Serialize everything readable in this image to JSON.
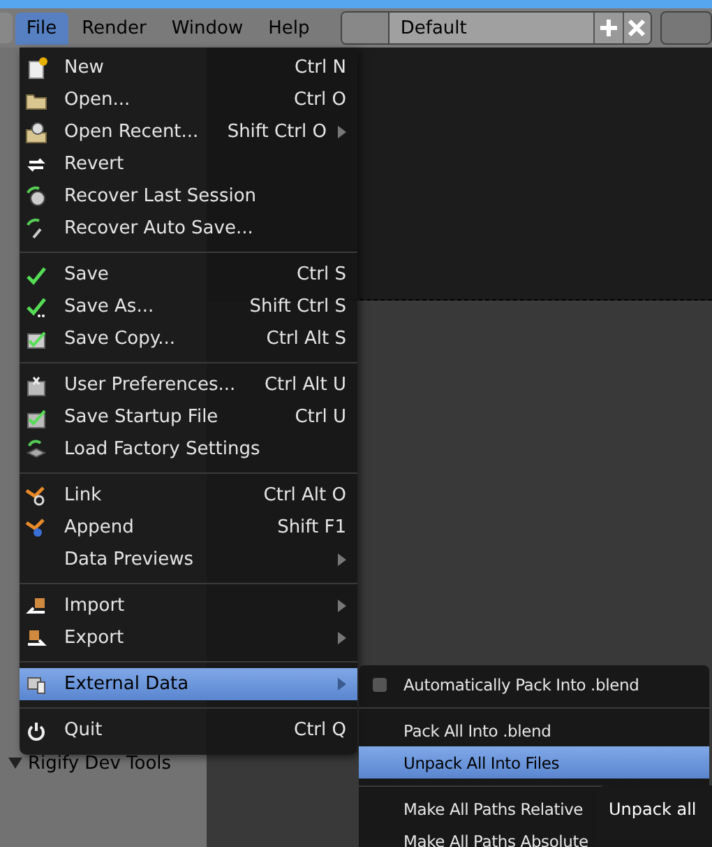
{
  "header": {
    "menus": [
      {
        "label": "File",
        "selected": true
      },
      {
        "label": "Render",
        "selected": false
      },
      {
        "label": "Window",
        "selected": false
      },
      {
        "label": "Help",
        "selected": false
      }
    ],
    "layout": "Default"
  },
  "toolshelf": {
    "panels": [
      {
        "label": "Rigify Dev Tools",
        "expanded": true
      }
    ]
  },
  "file_menu": {
    "sections": [
      [
        {
          "label": "New",
          "shortcut": "Ctrl N",
          "submenu": false,
          "selected": false
        },
        {
          "label": "Open...",
          "shortcut": "Ctrl O",
          "submenu": false,
          "selected": false
        },
        {
          "label": "Open Recent...",
          "shortcut": "Shift Ctrl O",
          "submenu": true,
          "selected": false
        },
        {
          "label": "Revert",
          "submenu": false,
          "selected": false
        },
        {
          "label": "Recover Last Session",
          "submenu": false,
          "selected": false
        },
        {
          "label": "Recover Auto Save...",
          "submenu": false,
          "selected": false
        }
      ],
      [
        {
          "label": "Save",
          "shortcut": "Ctrl S",
          "submenu": false,
          "selected": false
        },
        {
          "label": "Save As...",
          "shortcut": "Shift Ctrl S",
          "submenu": false,
          "selected": false
        },
        {
          "label": "Save Copy...",
          "shortcut": "Ctrl Alt S",
          "submenu": false,
          "selected": false
        }
      ],
      [
        {
          "label": "User Preferences...",
          "shortcut": "Ctrl Alt U",
          "submenu": false,
          "selected": false
        },
        {
          "label": "Save Startup File",
          "shortcut": "Ctrl U",
          "submenu": false,
          "selected": false
        },
        {
          "label": "Load Factory Settings",
          "submenu": false,
          "selected": false
        }
      ],
      [
        {
          "label": "Link",
          "shortcut": "Ctrl Alt O",
          "submenu": false,
          "selected": false
        },
        {
          "label": "Append",
          "shortcut": "Shift F1",
          "submenu": false,
          "selected": false
        },
        {
          "label": "Data Previews",
          "submenu": true,
          "selected": false
        }
      ],
      [
        {
          "label": "Import",
          "submenu": true,
          "selected": false
        },
        {
          "label": "Export",
          "submenu": true,
          "selected": false
        }
      ],
      [
        {
          "label": "External Data",
          "submenu": true,
          "selected": true
        }
      ],
      [
        {
          "label": "Quit",
          "shortcut": "Ctrl Q",
          "submenu": false,
          "selected": false
        }
      ]
    ]
  },
  "external_data_menu": {
    "sections": [
      [
        {
          "label": "Automatically Pack Into .blend",
          "kind": "checkbox",
          "checked": false,
          "selected": false
        }
      ],
      [
        {
          "label": "Pack All Into .blend",
          "kind": "action",
          "selected": false
        },
        {
          "label": "Unpack All Into Files",
          "kind": "action",
          "selected": true
        }
      ],
      [
        {
          "label": "Make All Paths Relative",
          "kind": "action",
          "selected": false
        },
        {
          "label": "Make All Paths Absolute",
          "kind": "action",
          "selected": false
        }
      ]
    ]
  },
  "tooltip": {
    "text": "Unpack all"
  }
}
